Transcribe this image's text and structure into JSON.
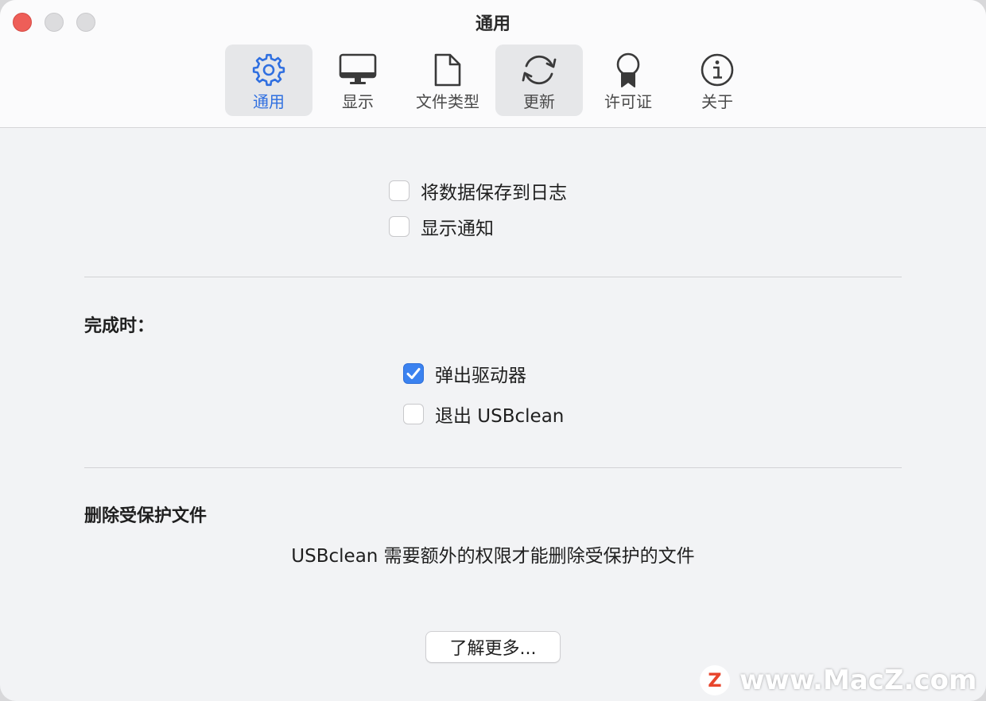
{
  "window": {
    "title": "通用"
  },
  "toolbar": {
    "tabs": [
      {
        "label": "通用",
        "icon": "gear-icon",
        "active": true
      },
      {
        "label": "显示",
        "icon": "monitor-icon",
        "active": false
      },
      {
        "label": "文件类型",
        "icon": "document-icon",
        "active": false
      },
      {
        "label": "更新",
        "icon": "refresh-icon",
        "active": false
      },
      {
        "label": "许可证",
        "icon": "ribbon-badge-icon",
        "active": false
      },
      {
        "label": "关于",
        "icon": "info-icon",
        "active": false
      }
    ]
  },
  "general": {
    "options": [
      {
        "label": "将数据保存到日志",
        "checked": false
      },
      {
        "label": "显示通知",
        "checked": false
      }
    ]
  },
  "on_complete": {
    "title": "完成时：",
    "options": [
      {
        "label": "弹出驱动器",
        "checked": true
      },
      {
        "label": "退出 USBclean",
        "checked": false
      }
    ]
  },
  "protected_files": {
    "title": "删除受保护文件",
    "description": "USBclean 需要额外的权限才能删除受保护的文件",
    "button_label": "了解更多..."
  },
  "watermark": {
    "text": "www.MacZ.com",
    "logo_letter": "Z"
  },
  "colors": {
    "accent": "#3b82f0",
    "active_tab_text": "#2f6fe0",
    "close_button": "#ee5e58",
    "background": "#f2f3f5"
  }
}
